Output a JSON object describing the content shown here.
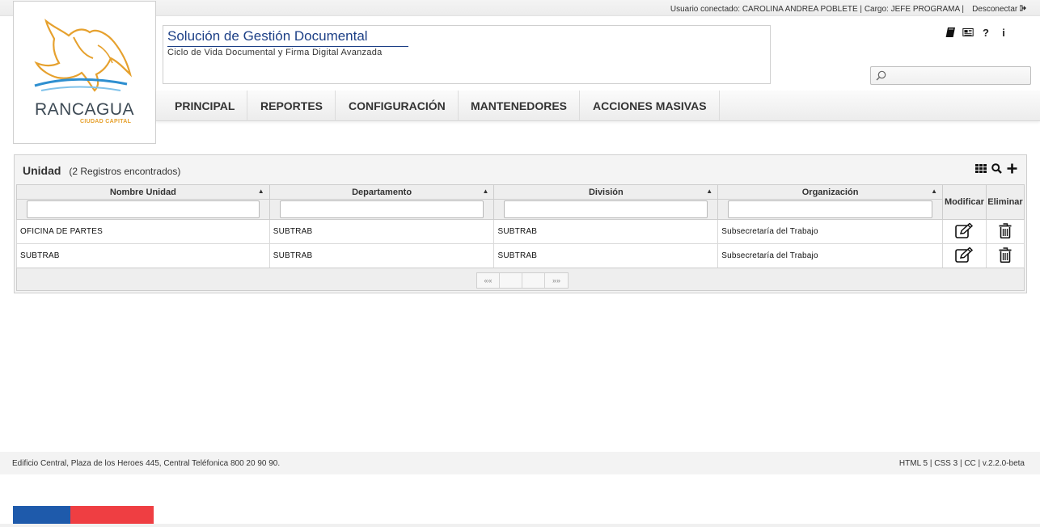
{
  "topbar": {
    "user_text": "Usuario conectado: CAROLINA ANDREA POBLETE | Cargo: JEFE PROGRAMA |",
    "logout_label": "Desconectar"
  },
  "logo": {
    "name": "RANCAGUA",
    "tagline": "CIUDAD CAPITAL"
  },
  "header": {
    "title": "Solución de Gestión Documental",
    "subtitle": "Ciclo de Vida Documental y Firma Digital Avanzada",
    "icons": [
      "book-icon",
      "newspaper-icon",
      "help-icon",
      "info-icon"
    ]
  },
  "search": {
    "placeholder": ""
  },
  "nav": {
    "items": [
      {
        "label": "PRINCIPAL"
      },
      {
        "label": "REPORTES"
      },
      {
        "label": "CONFIGURACIÓN"
      },
      {
        "label": "MANTENEDORES"
      },
      {
        "label": "ACCIONES MASIVAS"
      }
    ]
  },
  "panel": {
    "title": "Unidad",
    "count": "(2 Registros encontrados)",
    "columns": [
      "Nombre Unidad",
      "Departamento",
      "División",
      "Organización",
      "Modificar",
      "Eliminar"
    ],
    "rows": [
      [
        "OFICINA DE PARTES",
        "SUBTRAB",
        "SUBTRAB",
        "Subsecretaría del Trabajo"
      ],
      [
        "SUBTRAB",
        "SUBTRAB",
        "SUBTRAB",
        "Subsecretaría del Trabajo"
      ]
    ],
    "pager": {
      "first": "««",
      "prev": "",
      "next": "",
      "last": "»»"
    }
  },
  "footer": {
    "address": "Edificio Central, Plaza de los Heroes 445, Central Teléfonica 800 20 90 90.",
    "tech": "HTML 5 | CSS 3 | CC | v.2.2.0-beta"
  },
  "colors": {
    "title_blue": "#1c3f86",
    "flag_blue": "#1e5aab",
    "flag_red": "#ef3e42",
    "logo_orange": "#e6a12e"
  }
}
